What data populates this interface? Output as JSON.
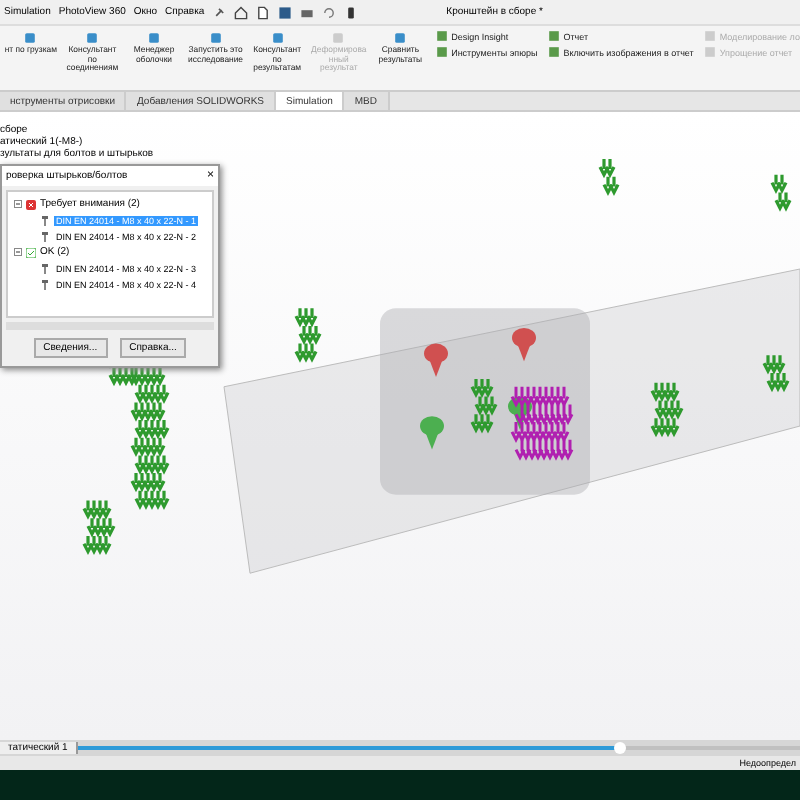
{
  "menu_bar": {
    "items": [
      "Simulation",
      "PhotoView 360",
      "Окно",
      "Справка"
    ],
    "title": "Кронштейн в сборе *"
  },
  "ribbon": {
    "buttons": [
      {
        "label": "нт по грузкам",
        "disabled": false
      },
      {
        "label": "Консультант по соединениям",
        "disabled": false
      },
      {
        "label": "Менеджер оболочки",
        "disabled": false
      },
      {
        "label": "Запустить это исследование",
        "disabled": false
      },
      {
        "label": "Консультант по результатам",
        "disabled": false
      },
      {
        "label": "Деформированный результат",
        "disabled": true
      },
      {
        "label": "Сравнить результаты",
        "disabled": false
      }
    ],
    "small_buttons": [
      {
        "label": "Design Insight",
        "disabled": false
      },
      {
        "label": "Инструменты эпюры",
        "disabled": false
      },
      {
        "label": "Отчет",
        "disabled": false
      },
      {
        "label": "Включить изображения в отчет",
        "disabled": false
      },
      {
        "label": "Моделирование ло",
        "disabled": true
      },
      {
        "label": "Упрощение отчет",
        "disabled": true
      }
    ]
  },
  "tabs": [
    {
      "label": "нструменты отрисовки",
      "selected": false
    },
    {
      "label": "Добавления SOLIDWORKS",
      "selected": false
    },
    {
      "label": "Simulation",
      "selected": true
    },
    {
      "label": "MBD",
      "selected": false
    }
  ],
  "feature_tree": [
    "сборе",
    "атический 1(-M8-)",
    "зультаты для болтов и штырьков"
  ],
  "dialog": {
    "title": "роверка штырьков/болтов",
    "close": "×",
    "groups": [
      {
        "label": "Требует внимания (2)",
        "kind": "warning",
        "expanded": true,
        "children": [
          {
            "label": "DIN EN 24014 - M8 x 40 x 22-N - 1",
            "selected": true
          },
          {
            "label": "DIN EN 24014 - M8 x 40 x 22-N - 2",
            "selected": false
          }
        ]
      },
      {
        "label": "OK (2)",
        "kind": "ok",
        "expanded": true,
        "children": [
          {
            "label": "DIN EN 24014 - M8 x 40 x 22-N - 3",
            "selected": false
          },
          {
            "label": "DIN EN 24014 - M8 x 40 x 22-N - 4",
            "selected": false
          }
        ]
      }
    ],
    "buttons": [
      "Сведения...",
      "Справка..."
    ]
  },
  "bottom_tab": "татический 1",
  "progress": {
    "level": 0.75
  },
  "status": "Недоопредел"
}
